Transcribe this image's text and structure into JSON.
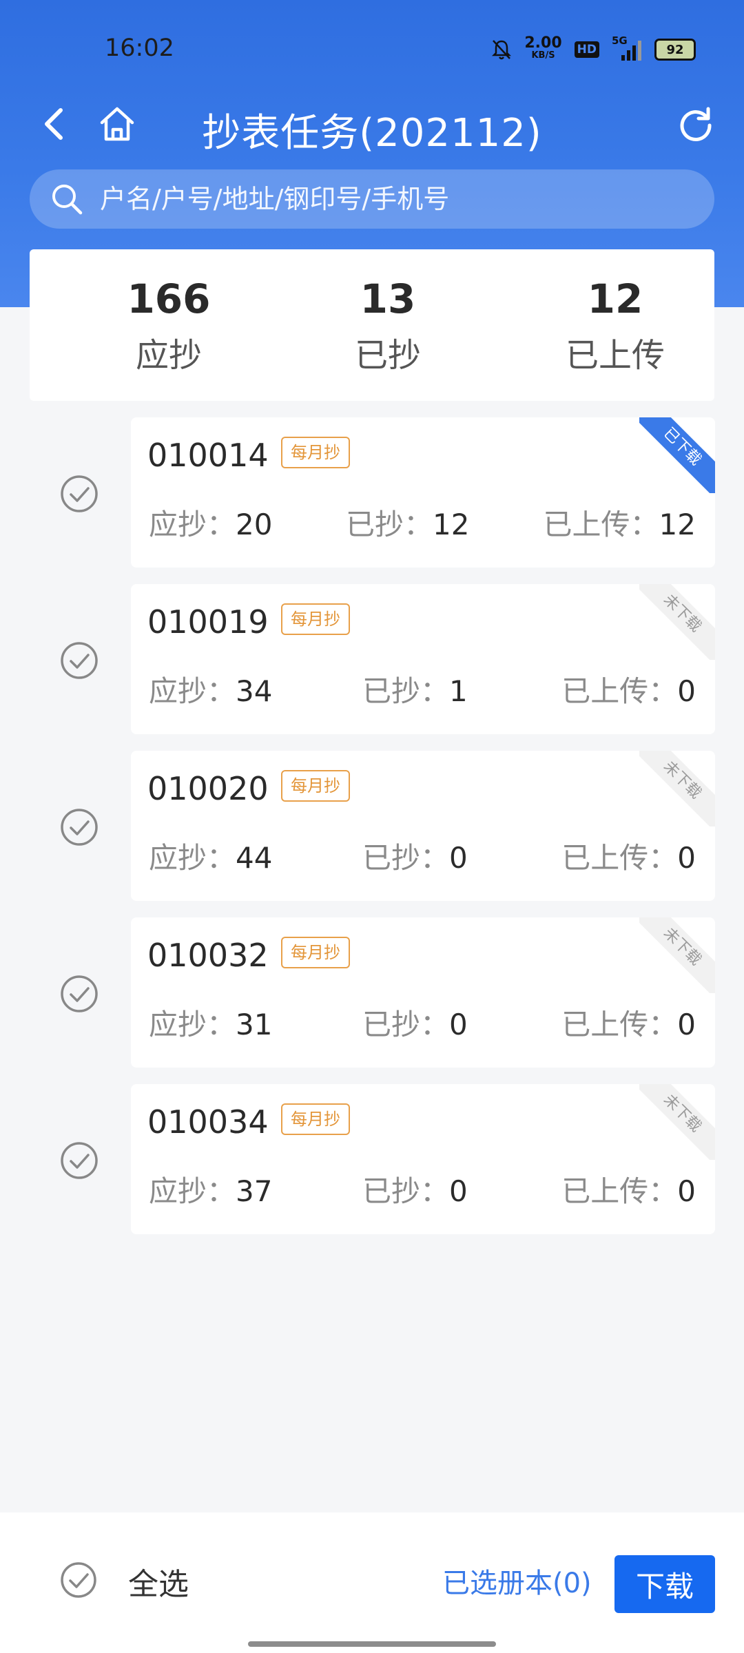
{
  "status_bar": {
    "time": "16:02",
    "net_speed": "2.00",
    "net_unit": "KB/S",
    "hd": "HD",
    "signal": "5G",
    "battery": "92"
  },
  "header": {
    "title": "抄表任务(202112)",
    "search_placeholder": "户名/户号/地址/钢印号/手机号"
  },
  "summary": [
    {
      "value": "166",
      "label": "应抄"
    },
    {
      "value": "13",
      "label": "已抄"
    },
    {
      "value": "12",
      "label": "已上传"
    }
  ],
  "labels": {
    "should_read": "应抄：",
    "read": "已抄：",
    "uploaded": "已上传："
  },
  "books": [
    {
      "code": "010014",
      "tag": "每月抄",
      "should": "20",
      "read": "12",
      "uploaded": "12",
      "status": "已下载"
    },
    {
      "code": "010019",
      "tag": "每月抄",
      "should": "34",
      "read": "1",
      "uploaded": "0",
      "status": "未下载"
    },
    {
      "code": "010020",
      "tag": "每月抄",
      "should": "44",
      "read": "0",
      "uploaded": "0",
      "status": "未下载"
    },
    {
      "code": "010032",
      "tag": "每月抄",
      "should": "31",
      "read": "0",
      "uploaded": "0",
      "status": "未下载"
    },
    {
      "code": "010034",
      "tag": "每月抄",
      "should": "37",
      "read": "0",
      "uploaded": "0",
      "status": "未下载"
    }
  ],
  "footer": {
    "select_all": "全选",
    "selected": "已选册本(0)",
    "download": "下载"
  },
  "colors": {
    "primary": "#3a7ae8",
    "tag_orange": "#e39538"
  }
}
